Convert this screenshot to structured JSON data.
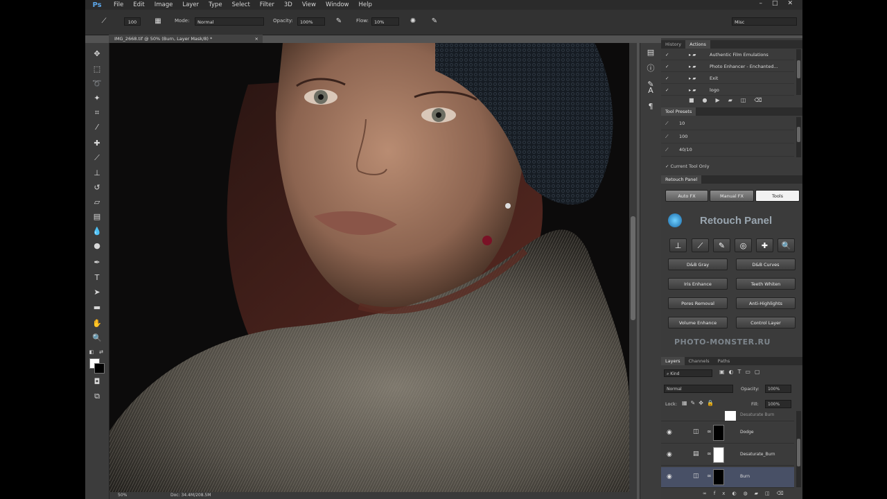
{
  "app": {
    "logo": "Ps"
  },
  "menu": [
    "File",
    "Edit",
    "Image",
    "Layer",
    "Type",
    "Select",
    "Filter",
    "3D",
    "View",
    "Window",
    "Help"
  ],
  "window_buttons": [
    "–",
    "□",
    "✕"
  ],
  "options": {
    "brush_size": "100",
    "mode_label": "Mode:",
    "mode_value": "Normal",
    "opacity_label": "Opacity:",
    "opacity_value": "100%",
    "flow_label": "Flow:",
    "flow_value": "10%",
    "workspace": "Misc"
  },
  "document_tab": {
    "title": "IMG_2668.tif @ 50% (Burn, Layer Mask/8) *",
    "close": "×"
  },
  "status": {
    "zoom": "50%",
    "doc": "Doc: 34.4M/208.5M"
  },
  "history_panel": {
    "tabs": [
      "History",
      "Actions"
    ],
    "actions": [
      {
        "check": "✓",
        "name": "Authentic Film Emulations"
      },
      {
        "check": "✓",
        "name": "Photo Enhancer - Enchanted..."
      },
      {
        "check": "✓",
        "name": "Exit"
      },
      {
        "check": "✓",
        "name": "logo"
      }
    ]
  },
  "tool_presets": {
    "title": "Tool Presets",
    "items": [
      "10",
      "100",
      "40/10"
    ],
    "current_only": "Current Tool Only"
  },
  "retouch": {
    "title": "Retouch Panel",
    "tabs": [
      "Auto FX",
      "Manual FX",
      "Tools"
    ],
    "header": "Retouch Panel",
    "buttons": [
      [
        "D&B Gray",
        "D&B Curves"
      ],
      [
        "Iris Enhance",
        "Teeth Whiten"
      ],
      [
        "Pores Removal",
        "Anti-Highlights"
      ],
      [
        "Volume Enhance",
        "Control Layer"
      ]
    ],
    "footer": "PHOTO-MONSTER.RU"
  },
  "layers": {
    "tabs": [
      "Layers",
      "Channels",
      "Paths"
    ],
    "kind": "Kind",
    "blend": "Normal",
    "opacity_label": "Opacity:",
    "opacity_value": "100%",
    "lock_label": "Lock:",
    "fill_label": "Fill:",
    "fill_value": "100%",
    "partial_layer": "Desaturate Burn",
    "items": [
      {
        "name": "Dodge",
        "mask": "black",
        "selected": false
      },
      {
        "name": "Desaturate_Burn",
        "mask": "white",
        "selected": false
      },
      {
        "name": "Burn",
        "mask": "black",
        "selected": true
      }
    ]
  },
  "colors": {
    "accent": "#5ca6e8",
    "selected_layer": "#485066"
  }
}
